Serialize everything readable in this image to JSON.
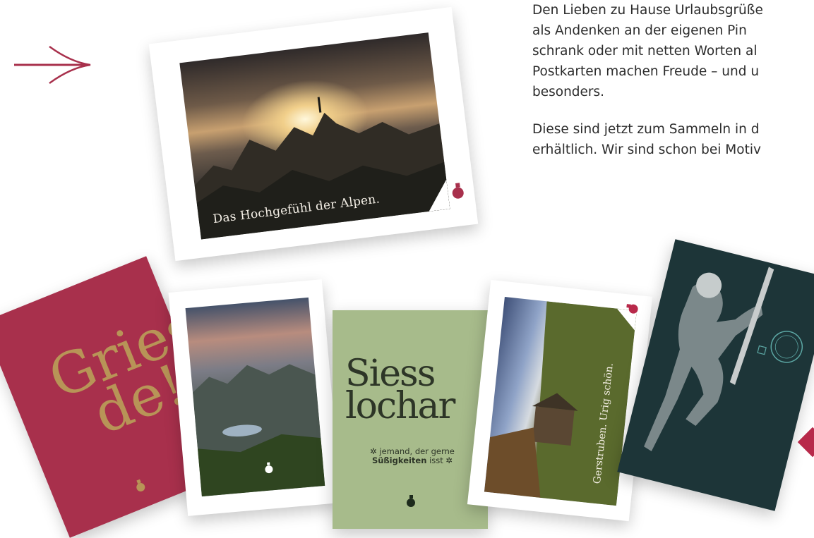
{
  "intro": {
    "paragraph1": "Den Lieben zu Hause Urlaubsgrüße\nals Andenken an der eigenen Pin\nschrank oder mit netten Worten al\nPostkarten machen Freude – und u\nbesonders.",
    "paragraph2": "Diese sind jetzt zum Sammeln in d\nerhältlich. Wir sind schon bei Motiv"
  },
  "cards": {
    "main": {
      "caption": "Das Hochgefühl der Alpen."
    },
    "red": {
      "line1": "Griess",
      "line2": "de!"
    },
    "green": {
      "line1": "Siess",
      "line2": "lochar",
      "sub_prefix": "✲ jemand, der gerne",
      "sub_bold": "Süßigkeiten",
      "sub_suffix": "isst ✲"
    },
    "hut": {
      "caption": "Gerstruben. Urig schön."
    }
  },
  "colors": {
    "brand_red": "#a8304c",
    "gold": "#b89457",
    "sage": "#a7bb8b",
    "teal": "#1d3538"
  },
  "icons": [
    "arrow-right-icon",
    "logo-drop-icon"
  ]
}
